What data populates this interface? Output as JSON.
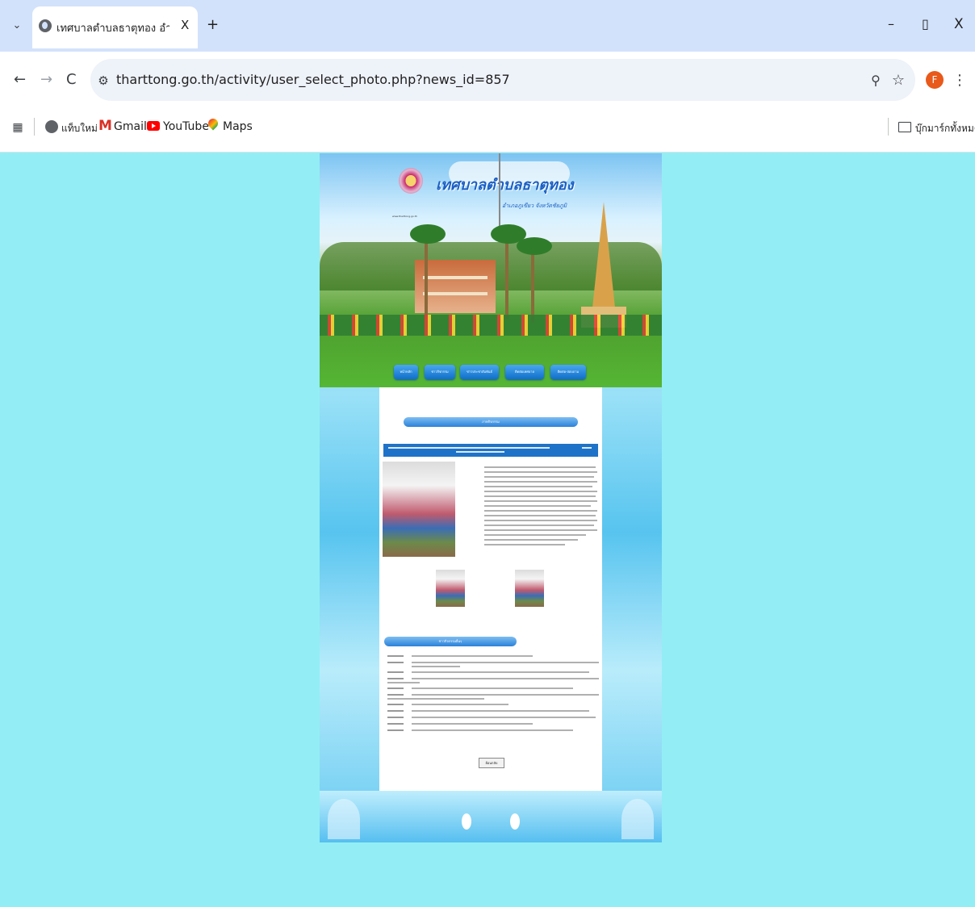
{
  "browser": {
    "tab": {
      "title": "เทศบาลตำบลธาตุทอง อำเภอภูเขียว ",
      "close_glyph": "X"
    },
    "new_tab_glyph": "+",
    "window_controls": {
      "minimize": "–",
      "restore": "▯",
      "close": "X"
    },
    "nav": {
      "back": "←",
      "forward": "→",
      "reload": "C"
    },
    "address": "tharttong.go.th/activity/user_select_photo.php?news_id=857",
    "profile_initial": "F",
    "bookmarks": [
      {
        "label": "แท็บใหม่"
      },
      {
        "label": "Gmail"
      },
      {
        "label": "YouTube"
      },
      {
        "label": "Maps"
      }
    ],
    "all_bookmarks": "บุ๊กมาร์กทั้งหมด"
  },
  "site": {
    "title": "เทศบาลตำบลธาตุทอง",
    "subtitle": "อำเภอภูเขียว จังหวัดชัยภูมิ",
    "logo_caption": "www.tharttong.go.th",
    "nav": [
      "หน้าหลัก",
      "ข่าวกิจกรรม",
      "ข่าวประชาสัมพันธ์",
      "ติดต่อเทศบาล",
      "ติดต่อ-สอบถาม"
    ],
    "section_header": "ภาพกิจกรรม",
    "other_news_header": "ข่าวกิจกรรมอื่นๆ",
    "back_button": "ย้อนกลับ"
  },
  "colors": {
    "background": "#92eef4",
    "title_bar": "#1e73c8",
    "nav_button": "#1a7fd8",
    "tab_strip": "#d3e2fb"
  }
}
